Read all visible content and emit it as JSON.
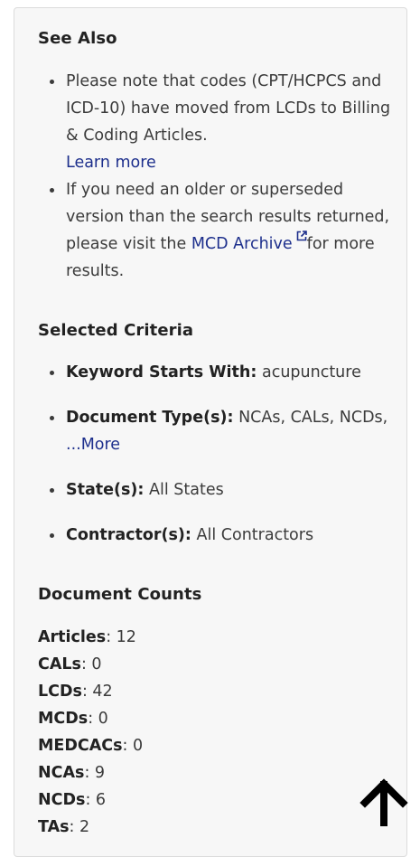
{
  "see_also": {
    "heading": "See Also",
    "item1_text": "Please note that codes (CPT/HCPCS and ICD-10) have moved from LCDs to Billing & Coding Articles.",
    "item1_link": "Learn more",
    "item2_text": "If you need an older or superseded version than the search results returned, please visit the",
    "item2_link": "MCD Archive",
    "item2_after": "for more results."
  },
  "selected_criteria": {
    "heading": "Selected Criteria",
    "keyword_label": "Keyword Starts With:",
    "keyword_value": "acupuncture",
    "doc_type_label": "Document Type(s):",
    "doc_type_value": "NCAs, CALs, NCDs, ",
    "doc_type_more": "...More",
    "state_label": "State(s):",
    "state_value": "All States",
    "contractor_label": "Contractor(s):",
    "contractor_value": "All Contractors"
  },
  "document_counts": {
    "heading": "Document Counts",
    "rows": [
      {
        "label": "Articles",
        "value": ": 12"
      },
      {
        "label": "CALs",
        "value": ": 0"
      },
      {
        "label": "LCDs",
        "value": ": 42"
      },
      {
        "label": "MCDs",
        "value": ": 0"
      },
      {
        "label": "MEDCACs",
        "value": ": 0"
      },
      {
        "label": "NCAs",
        "value": ": 9"
      },
      {
        "label": "NCDs",
        "value": ": 6"
      },
      {
        "label": "TAs",
        "value": ": 2"
      }
    ]
  },
  "icons": {
    "external_link": "external-link-icon",
    "back_to_top": "arrow-up-icon"
  },
  "colors": {
    "link": "#1d2f8c",
    "panel_bg": "#f7f7f7",
    "text": "#3b3b3b"
  }
}
